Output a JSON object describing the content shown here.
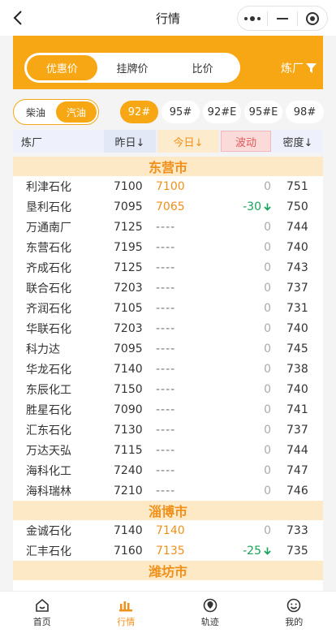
{
  "nav": {
    "title": "行情"
  },
  "banner": {
    "price_types": [
      "优惠价",
      "挂牌价",
      "比价"
    ],
    "active_price_type": 0,
    "refinery_filter": "炼厂"
  },
  "fuel": {
    "types": [
      "柴油",
      "汽油"
    ],
    "active_type": 1,
    "grades": [
      "92#",
      "95#",
      "92#E",
      "95#E",
      "98#"
    ],
    "active_grade": 0
  },
  "table_header": {
    "refinery": "炼厂",
    "yesterday": "昨日↓",
    "today": "今日↓",
    "change": "波动",
    "density": "密度↓"
  },
  "groups": [
    {
      "city": "东营市",
      "rows": [
        {
          "name": "利津石化",
          "yesterday": "7100",
          "today": "7100",
          "change": "0",
          "density": "751"
        },
        {
          "name": "垦利石化",
          "yesterday": "7095",
          "today": "7065",
          "change": "-30",
          "density": "750"
        },
        {
          "name": "万通南厂",
          "yesterday": "7125",
          "today": "----",
          "change": "0",
          "density": "744"
        },
        {
          "name": "东营石化",
          "yesterday": "7195",
          "today": "----",
          "change": "0",
          "density": "740"
        },
        {
          "name": "齐成石化",
          "yesterday": "7125",
          "today": "----",
          "change": "0",
          "density": "743"
        },
        {
          "name": "联合石化",
          "yesterday": "7203",
          "today": "----",
          "change": "0",
          "density": "737"
        },
        {
          "name": "齐润石化",
          "yesterday": "7105",
          "today": "----",
          "change": "0",
          "density": "731"
        },
        {
          "name": "华联石化",
          "yesterday": "7203",
          "today": "----",
          "change": "0",
          "density": "740"
        },
        {
          "name": "科力达",
          "yesterday": "7095",
          "today": "----",
          "change": "0",
          "density": "745"
        },
        {
          "name": "华龙石化",
          "yesterday": "7140",
          "today": "----",
          "change": "0",
          "density": "738"
        },
        {
          "name": "东辰化工",
          "yesterday": "7150",
          "today": "----",
          "change": "0",
          "density": "740"
        },
        {
          "name": "胜星石化",
          "yesterday": "7090",
          "today": "----",
          "change": "0",
          "density": "741"
        },
        {
          "name": "汇东石化",
          "yesterday": "7130",
          "today": "----",
          "change": "0",
          "density": "737"
        },
        {
          "name": "万达天弘",
          "yesterday": "7115",
          "today": "----",
          "change": "0",
          "density": "744"
        },
        {
          "name": "海科化工",
          "yesterday": "7240",
          "today": "----",
          "change": "0",
          "density": "747"
        },
        {
          "name": "海科瑞林",
          "yesterday": "7210",
          "today": "----",
          "change": "0",
          "density": "746"
        }
      ]
    },
    {
      "city": "淄博市",
      "rows": [
        {
          "name": "金诚石化",
          "yesterday": "7140",
          "today": "7140",
          "change": "0",
          "density": "733"
        },
        {
          "name": "汇丰石化",
          "yesterday": "7160",
          "today": "7135",
          "change": "-25",
          "density": "735"
        }
      ]
    },
    {
      "city": "潍坊市",
      "rows": []
    }
  ],
  "tabbar": {
    "items": [
      "首页",
      "行情",
      "轨迹",
      "我的"
    ],
    "active": 1
  },
  "colors": {
    "accent": "#f7a713",
    "accent_text": "#f0901a",
    "down": "#17a25a",
    "change_header": "#e05a5a"
  }
}
